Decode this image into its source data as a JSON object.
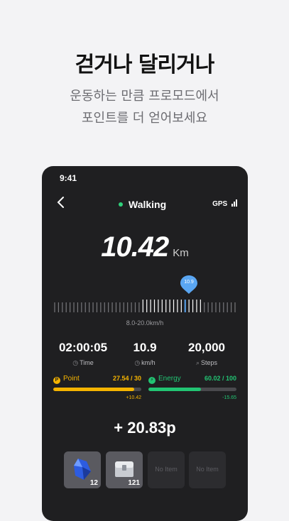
{
  "hero": {
    "title": "걷거나 달리거나",
    "subtitle_line1": "운동하는 만큼 프로모드에서",
    "subtitle_line2": "포인트를 더 얻어보세요"
  },
  "phone": {
    "status_time": "9:41",
    "mode_label": "Walking",
    "gps_label": "GPS",
    "distance_value": "10.42",
    "distance_unit": "Km",
    "speed_pin": "10.9",
    "speed_range": "8.0-20.0km/h",
    "stats": [
      {
        "value": "02:00:05",
        "label": "Time",
        "icon": "clock-icon"
      },
      {
        "value": "10.9",
        "label": "km/h",
        "icon": "speed-icon"
      },
      {
        "value": "20,000",
        "label": "Steps",
        "icon": "footprint-icon"
      }
    ],
    "point": {
      "label": "Point",
      "ratio": "27.54 / 30",
      "delta": "+10.42",
      "fill": 0.918,
      "color": "#f5b400"
    },
    "energy": {
      "label": "Energy",
      "ratio": "60.02 / 100",
      "delta": "-15.65",
      "fill": 0.6,
      "color": "#22c473"
    },
    "earned": "+ 20.83p",
    "items": [
      {
        "type": "filled",
        "count": "12",
        "icon": "crystal-icon"
      },
      {
        "type": "filled",
        "count": "121",
        "icon": "treasure-box-icon"
      },
      {
        "type": "empty",
        "label": "No Item"
      },
      {
        "type": "empty",
        "label": "No Item"
      }
    ]
  }
}
